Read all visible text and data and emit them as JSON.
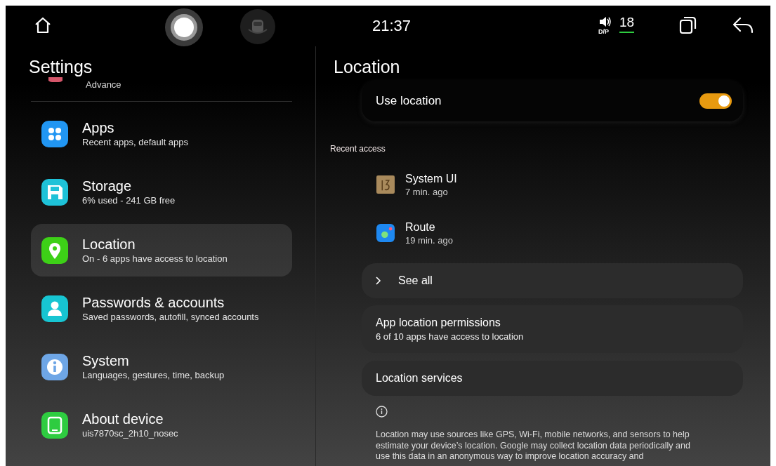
{
  "status_bar": {
    "time": "21:37",
    "sound_mode": "D/P",
    "volume": "18"
  },
  "sidebar": {
    "title": "Settings",
    "partial_item": {
      "subtitle": "Advance"
    },
    "items": [
      {
        "kind": "apps",
        "title": "Apps",
        "subtitle": "Recent apps, default apps",
        "selected": false
      },
      {
        "kind": "storage",
        "title": "Storage",
        "subtitle": "6% used - 241 GB free",
        "selected": false
      },
      {
        "kind": "location",
        "title": "Location",
        "subtitle": "On - 6 apps have access to location",
        "selected": true
      },
      {
        "kind": "accounts",
        "title": "Passwords & accounts",
        "subtitle": "Saved passwords, autofill, synced accounts",
        "selected": false
      },
      {
        "kind": "system",
        "title": "System",
        "subtitle": "Languages, gestures, time, backup",
        "selected": false
      },
      {
        "kind": "device",
        "title": "About device",
        "subtitle": "uis7870sc_2h10_nosec",
        "selected": false
      }
    ]
  },
  "page": {
    "title": "Location",
    "use_location": {
      "label": "Use location",
      "on": true
    },
    "recent_access": {
      "heading": "Recent access",
      "apps": [
        {
          "kind": "system_ui",
          "name": "System UI",
          "time": "7 min. ago"
        },
        {
          "kind": "route",
          "name": "Route",
          "time": "19 min. ago"
        }
      ]
    },
    "see_all": {
      "label": "See all"
    },
    "rows": [
      {
        "title": "App location permissions",
        "subtitle": "6 of 10 apps have access to location"
      },
      {
        "title": "Location services"
      }
    ],
    "info": "Location may use sources like GPS, Wi-Fi, mobile networks, and sensors to help estimate your device’s location. Google may collect location data periodically and use this data in an anonymous way to improve location accuracy and"
  }
}
